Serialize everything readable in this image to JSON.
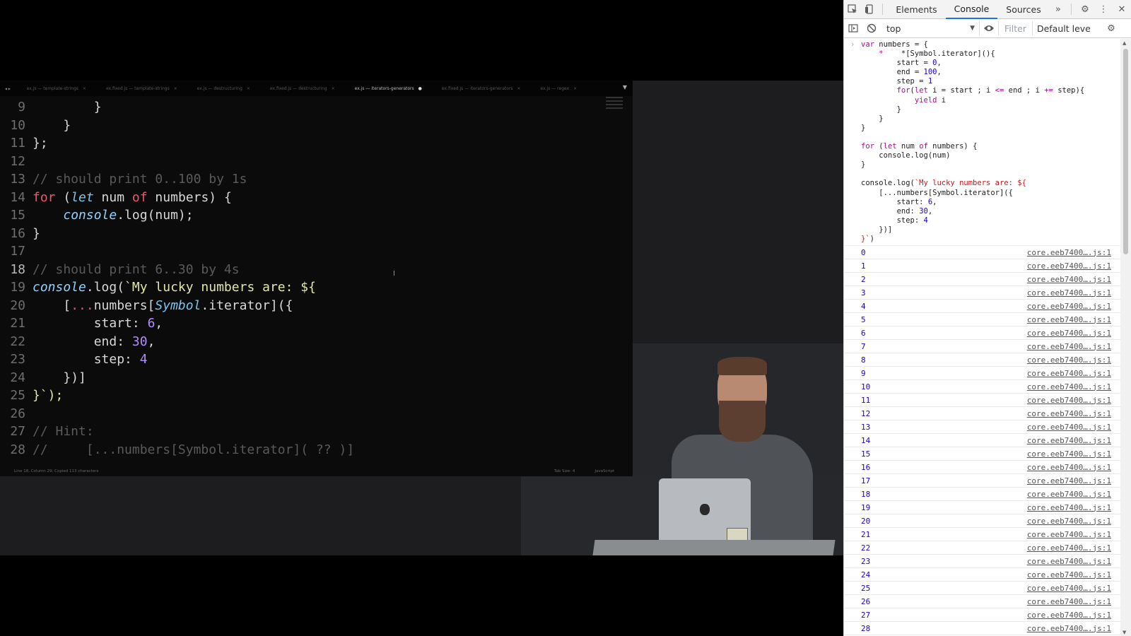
{
  "editor": {
    "tabs": [
      {
        "label": "ex.js — template-strings",
        "active": false
      },
      {
        "label": "ex.fixed.js — template-strings",
        "active": false
      },
      {
        "label": "ex.js — destructuring",
        "active": false
      },
      {
        "label": "ex.fixed.js — destructuring",
        "active": false
      },
      {
        "label": "ex.js — iterators-generators",
        "active": true
      },
      {
        "label": "ex.fixed.js — iterators-generators",
        "active": false
      },
      {
        "label": "ex.js — regex",
        "active": false
      }
    ],
    "status_left": "Line 18, Column 29; Copied 113 characters",
    "status_tab_size": "Tab Size: 4",
    "status_syntax": "JavaScript",
    "code_lines": [
      "9",
      "10",
      "11",
      "12",
      "13",
      "14",
      "15",
      "16",
      "17",
      "18",
      "19",
      "20",
      "21",
      "22",
      "23",
      "24",
      "25",
      "26",
      "27",
      "28"
    ],
    "code": {
      "l13": "// should print 0..100 by 1s",
      "l14_for": "for",
      "l14_let": "let",
      "l14_num": " num ",
      "l14_of": "of",
      "l14_rest": " numbers) {",
      "l15_console": "console",
      "l15_rest": ".log(num);",
      "l18": "// should print 6..30 by 4s",
      "l19_console": "console",
      "l19_log": ".log(",
      "l19_str": "`My lucky numbers are: ${",
      "l20_spread": "...",
      "l20_numbers": "numbers[",
      "l20_symbol": "Symbol",
      "l20_rest": ".iterator]({",
      "l21_key": "start: ",
      "l21_val": "6",
      "l22_key": "end: ",
      "l22_val": "30",
      "l23_key": "step: ",
      "l23_val": "4",
      "l24": "})]",
      "l25": "}`);",
      "l27": "// Hint:",
      "l28": "//     [...numbers[Symbol.iterator]( ?? )]"
    }
  },
  "devtools": {
    "tabs": [
      "Elements",
      "Console",
      "Sources"
    ],
    "active_tab": "Console",
    "more_tabs": "»",
    "context": "top",
    "filter_placeholder": "Filter",
    "level": "Default leve",
    "input_code": {
      "l1a": "var",
      "l1b": " numbers = {",
      "l2": "    *[Symbol.iterator](){",
      "l3a": "        start = ",
      "l3b": "0",
      "l3c": ",",
      "l4a": "        end = ",
      "l4b": "100",
      "l4c": ",",
      "l5a": "        step = ",
      "l5b": "1",
      "l6a": "        ",
      "l6b": "for",
      "l6c": "(",
      "l6d": "let",
      "l6e": " i = start ; i ",
      "l6f": "<=",
      "l6g": " end ; i ",
      "l6h": "+=",
      "l6i": " step){",
      "l7a": "            ",
      "l7b": "yield",
      "l7c": " i",
      "l8": "        }",
      "l9": "    }",
      "l10": "}",
      "l11": "",
      "l12a": "for",
      "l12b": " (",
      "l12c": "let",
      "l12d": " num ",
      "l12e": "of",
      "l12f": " numbers) {",
      "l13": "    console.log(num)",
      "l14": "}",
      "l15": "",
      "l16a": "console.log(",
      "l16b": "`My lucky numbers are: ${",
      "l17": "    [...numbers[Symbol.iterator]({",
      "l18a": "        start: ",
      "l18b": "6",
      "l18c": ",",
      "l19a": "        end: ",
      "l19b": "30",
      "l19c": ",",
      "l20a": "        step: ",
      "l20b": "4",
      "l21": "    })]",
      "l22a": "}`",
      "l22b": ")"
    },
    "logs": [
      "0",
      "1",
      "2",
      "3",
      "4",
      "5",
      "6",
      "7",
      "8",
      "9",
      "10",
      "11",
      "12",
      "13",
      "14",
      "15",
      "16",
      "17",
      "18",
      "19",
      "20",
      "21",
      "22",
      "23",
      "24",
      "25",
      "26",
      "27",
      "28"
    ],
    "log_source": "core.eeb7400….js:1"
  }
}
